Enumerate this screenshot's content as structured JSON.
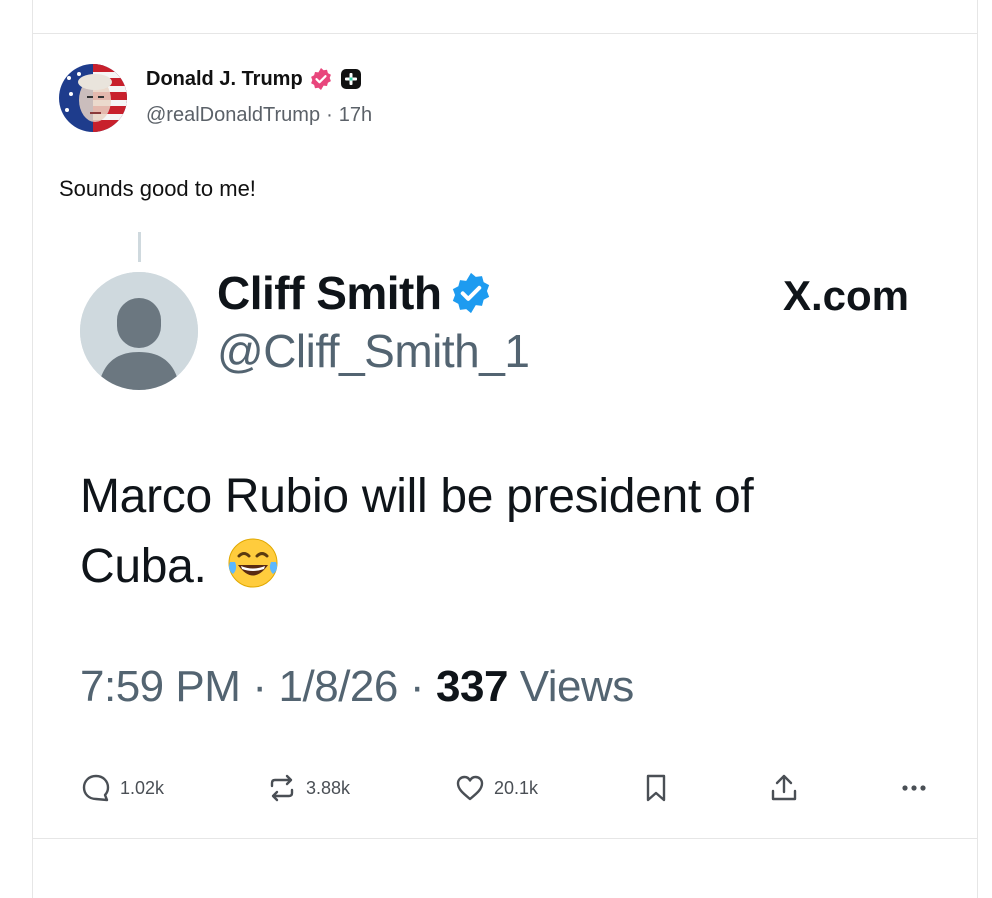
{
  "post": {
    "author_name": "Donald J. Trump",
    "handle": "@realDonaldTrump",
    "separator": "·",
    "time_ago": "17h",
    "text": "Sounds good to me!"
  },
  "embed": {
    "name": "Cliff Smith",
    "handle": "@Cliff_Smith_1",
    "source": "X.com",
    "text": "Marco Rubio will be president of Cuba.",
    "time": "7:59 PM",
    "sep1": "·",
    "date": "1/8/26",
    "sep2": "·",
    "views_count": "337",
    "views_label": "Views"
  },
  "actions": {
    "replies": "1.02k",
    "reposts": "3.88k",
    "likes": "20.1k"
  },
  "colors": {
    "verified_pink": "#e8467c",
    "verified_blue": "#1d9bf0",
    "muted": "#536471"
  },
  "icons": [
    "verified-badge-icon",
    "plus-badge-icon",
    "reply-icon",
    "repost-icon",
    "like-icon",
    "bookmark-icon",
    "share-icon",
    "more-icon",
    "laughing-emoji-icon"
  ]
}
